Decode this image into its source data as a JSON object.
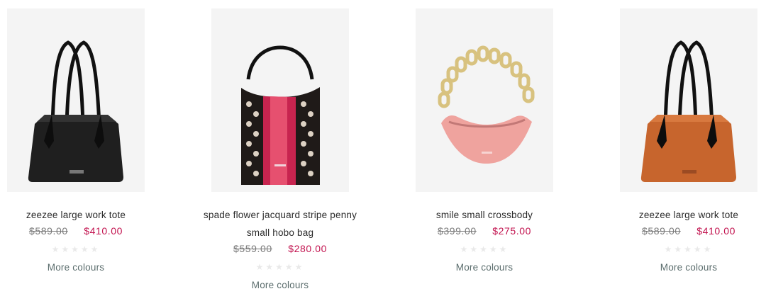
{
  "products": [
    {
      "title": "zeezee large work tote",
      "price_original": "$589.00",
      "price_sale": "$410.00",
      "rating_stars": "★★★★★",
      "more_colours": "More colours",
      "bag_icon": "black-tote-bag-image",
      "colors": {
        "body": "#1f1f1f",
        "handle": "#111111"
      }
    },
    {
      "title": "spade flower jacquard stripe penny small hobo bag",
      "price_original": "$559.00",
      "price_sale": "$280.00",
      "rating_stars": "★★★★★",
      "more_colours": "More colours",
      "bag_icon": "jacquard-hobo-bag-image",
      "colors": {
        "body": "#1f1a18",
        "stripe": "#c7244f"
      }
    },
    {
      "title": "smile small crossbody",
      "price_original": "$399.00",
      "price_sale": "$275.00",
      "rating_stars": "★★★★★",
      "more_colours": "More colours",
      "bag_icon": "pink-crossbody-bag-image",
      "colors": {
        "body": "#efa39e",
        "chain": "#d8c27f"
      }
    },
    {
      "title": "zeezee large work tote",
      "price_original": "$589.00",
      "price_sale": "$410.00",
      "rating_stars": "★★★★★",
      "more_colours": "More colours",
      "bag_icon": "brown-tote-bag-image",
      "colors": {
        "body": "#c7652d",
        "handle": "#111111"
      }
    }
  ]
}
